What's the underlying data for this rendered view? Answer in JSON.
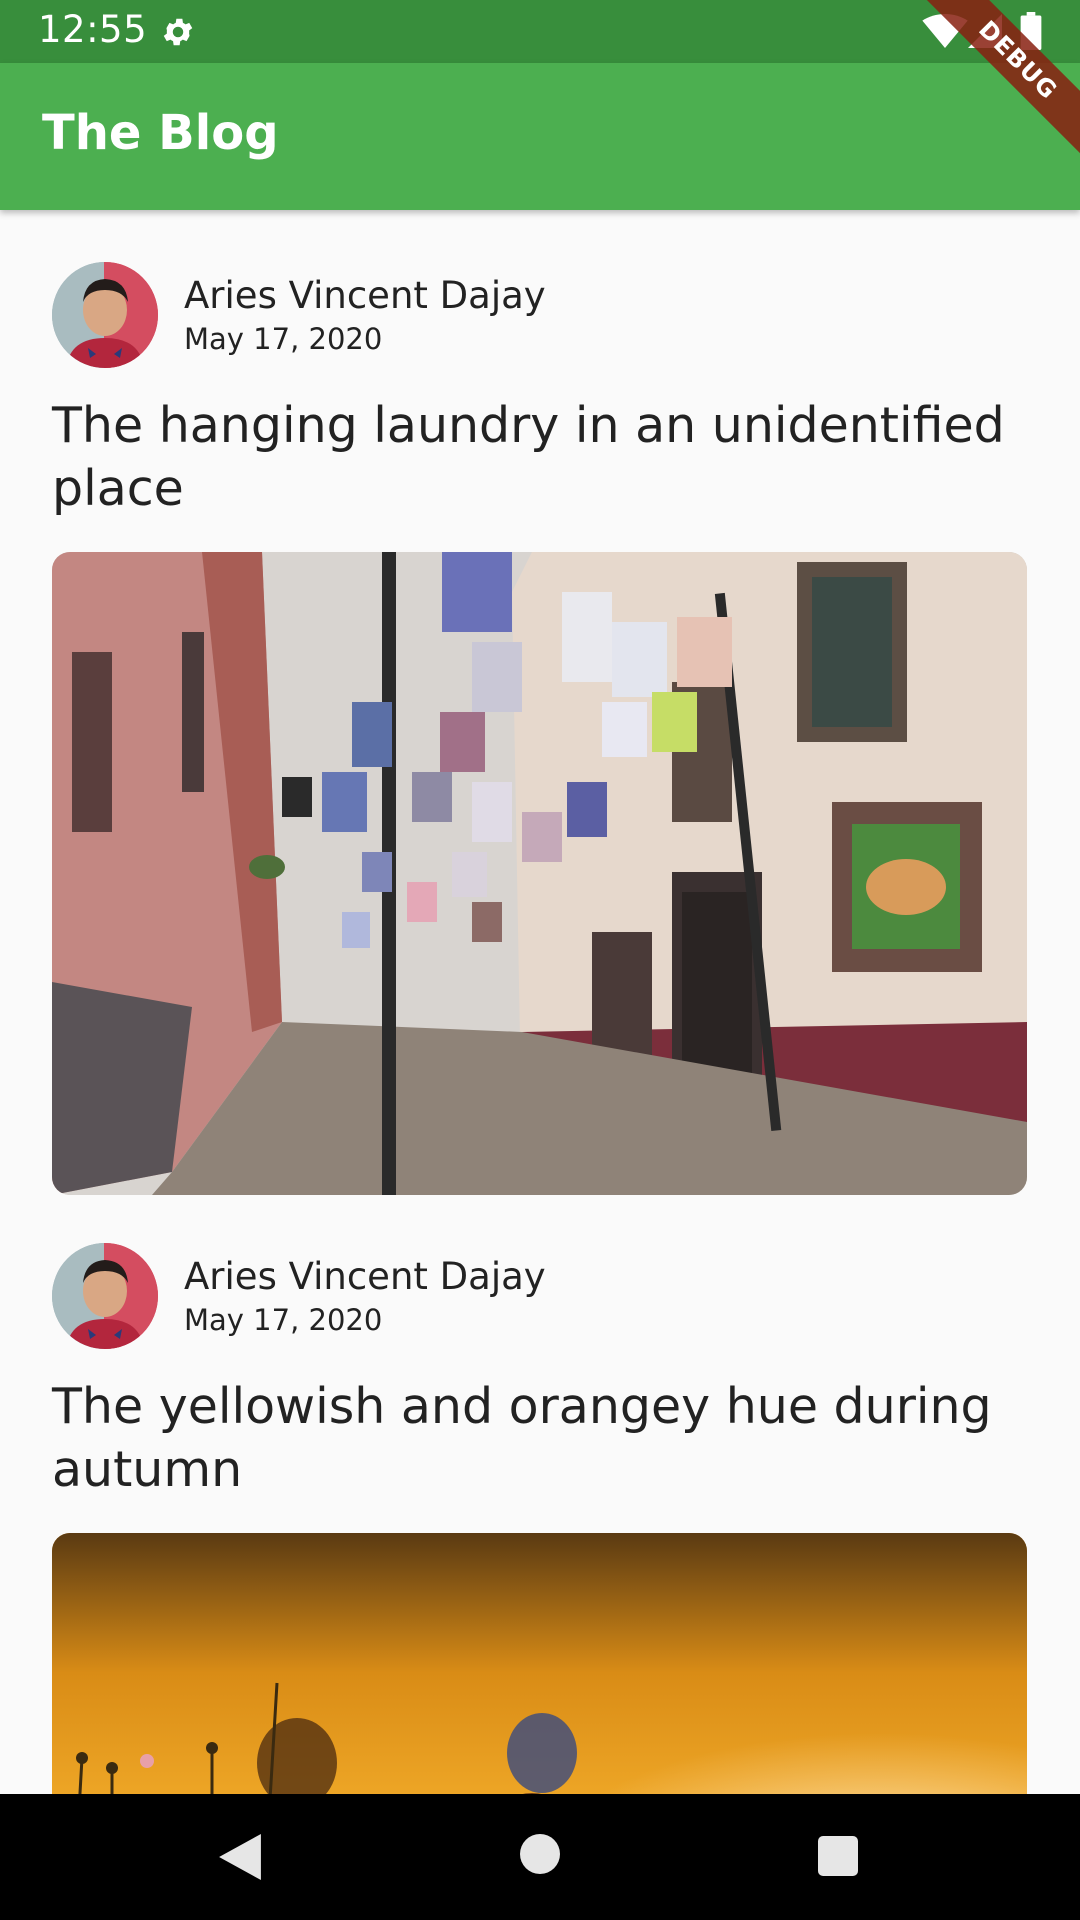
{
  "status_bar": {
    "time": "12:55",
    "icons": [
      "gear-icon",
      "wifi-icon",
      "signal-icon",
      "battery-icon"
    ]
  },
  "app_bar": {
    "title": "The Blog",
    "color": "#4caf50",
    "status_color": "#388e3c"
  },
  "debug_banner": "DEBUG",
  "posts": [
    {
      "author": "Aries Vincent Dajay",
      "date": "May 17, 2020",
      "title": "The hanging laundry in an unidentified place",
      "image": "street-with-hanging-laundry"
    },
    {
      "author": "Aries Vincent Dajay",
      "date": "May 17, 2020",
      "title": "The yellowish and orangey hue during autumn",
      "image": "autumn-golden-field"
    }
  ],
  "nav_bar": {
    "icons": [
      "back-icon",
      "home-icon",
      "recents-icon"
    ]
  }
}
